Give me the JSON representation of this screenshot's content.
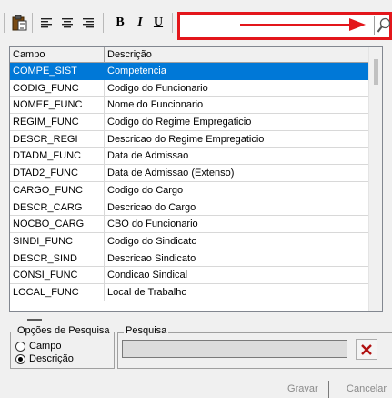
{
  "toolbar": {
    "search_value": "",
    "accent_color": "#e3161b",
    "buttons": {
      "paste": "paste-icon",
      "align_left": "align-left-icon",
      "align_center": "align-center-icon",
      "align_right": "align-right-icon",
      "bold": "B",
      "italic": "I",
      "underline": "U",
      "search": "magnifier-icon"
    }
  },
  "grid": {
    "columns": [
      "Campo",
      "Descrição"
    ],
    "selected_color": "#0078d7",
    "rows": [
      {
        "campo": "COMPE_SIST",
        "descricao": "Competencia",
        "selected": true
      },
      {
        "campo": "CODIG_FUNC",
        "descricao": "Codigo do Funcionario"
      },
      {
        "campo": "NOMEF_FUNC",
        "descricao": "Nome do Funcionario"
      },
      {
        "campo": "REGIM_FUNC",
        "descricao": "Codigo do Regime Empregaticio"
      },
      {
        "campo": "DESCR_REGI",
        "descricao": "Descricao do Regime Empregaticio"
      },
      {
        "campo": "DTADM_FUNC",
        "descricao": "Data de Admissao"
      },
      {
        "campo": "DTAD2_FUNC",
        "descricao": "Data de Admissao (Extenso)"
      },
      {
        "campo": "CARGO_FUNC",
        "descricao": "Codigo do Cargo"
      },
      {
        "campo": "DESCR_CARG",
        "descricao": "Descricao do Cargo"
      },
      {
        "campo": "NOCBO_CARG",
        "descricao": "CBO do Funcionario"
      },
      {
        "campo": "SINDI_FUNC",
        "descricao": "Codigo do Sindicato"
      },
      {
        "campo": "DESCR_SIND",
        "descricao": "Descricao Sindicato"
      },
      {
        "campo": "CONSI_FUNC",
        "descricao": "Condicao Sindical"
      },
      {
        "campo": "LOCAL_FUNC",
        "descricao": "Local de Trabalho"
      }
    ]
  },
  "search_options": {
    "title": "Opções de Pesquisa",
    "options": [
      "Campo",
      "Descrição"
    ],
    "selected_index": 1
  },
  "search": {
    "title": "Pesquisa",
    "value": ""
  },
  "footer": {
    "save_prefix": "",
    "save_accel": "G",
    "save_rest": "ravar",
    "cancel_accel": "C",
    "cancel_rest": "ancelar"
  }
}
